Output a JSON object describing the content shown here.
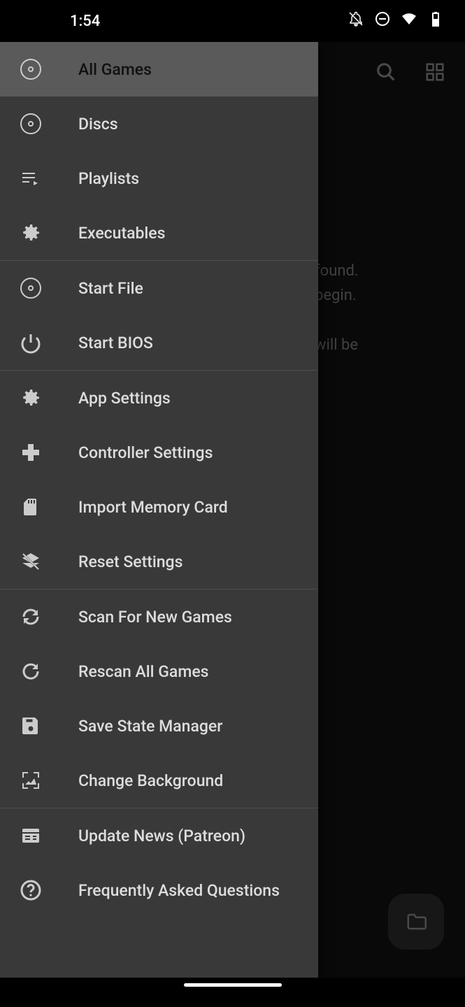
{
  "status": {
    "time": "1:54"
  },
  "main": {
    "hint": " found.\n begin.\n\n will be"
  },
  "drawer": {
    "groups": [
      {
        "items": [
          {
            "icon": "disc",
            "label": "All Games",
            "highlighted": true
          },
          {
            "icon": "disc",
            "label": "Discs"
          },
          {
            "icon": "playlist",
            "label": "Playlists"
          },
          {
            "icon": "gear",
            "label": "Executables"
          }
        ]
      },
      {
        "items": [
          {
            "icon": "disc",
            "label": "Start File"
          },
          {
            "icon": "power",
            "label": "Start BIOS"
          }
        ]
      },
      {
        "items": [
          {
            "icon": "gear",
            "label": "App Settings"
          },
          {
            "icon": "dpad",
            "label": "Controller Settings"
          },
          {
            "icon": "sdcard",
            "label": "Import Memory Card"
          },
          {
            "icon": "layers-off",
            "label": "Reset Settings"
          }
        ]
      },
      {
        "items": [
          {
            "icon": "sync",
            "label": "Scan For New Games"
          },
          {
            "icon": "refresh",
            "label": "Rescan All Games"
          },
          {
            "icon": "save",
            "label": "Save State Manager"
          },
          {
            "icon": "wallpaper",
            "label": "Change Background"
          }
        ]
      },
      {
        "items": [
          {
            "icon": "news",
            "label": "Update News (Patreon)"
          },
          {
            "icon": "help",
            "label": "Frequently Asked Questions"
          }
        ]
      }
    ]
  }
}
